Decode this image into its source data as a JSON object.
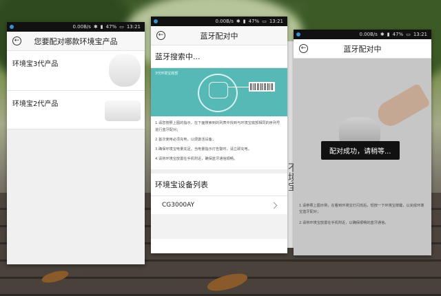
{
  "status": {
    "speed": "0.00B/s",
    "battery": "47%",
    "time": "13:21"
  },
  "screen1": {
    "title": "您要配对哪款环境宝产品",
    "products": [
      {
        "name": "环境宝3代产品"
      },
      {
        "name": "环境宝2代产品"
      }
    ]
  },
  "screen2": {
    "title": "蓝牙配对中",
    "searching": "蓝牙搜索中...",
    "diagram_label": "3代环境宝底部",
    "instructions": [
      "1.请您按照上图的指示，在下面搜索到的列表中找到与环境宝底部相同的序列号进行蓝牙配对；",
      "2.首次使用必须充电，以便激活设备；",
      "3.确保环境宝电量充足，当电量指示灯告警时，请立即充电。",
      "4.请将环境宝放置在手机附近，确保蓝牙通信顺畅。"
    ],
    "list_title": "环境宝设备列表",
    "devices": [
      "CG3000AY"
    ]
  },
  "screen3": {
    "title": "蓝牙配对中",
    "toast": "配对成功，请稍等...",
    "instructions": [
      "1.请参照上图示例，在看到环境宝灯闪烁后，轻按一下环境宝按键，以完成环境宝蓝牙配对；",
      "2.请将环境宝放置在手机附近，以确保顺畅的蓝牙通信。"
    ]
  },
  "background": {
    "box_text": "不境宝"
  }
}
